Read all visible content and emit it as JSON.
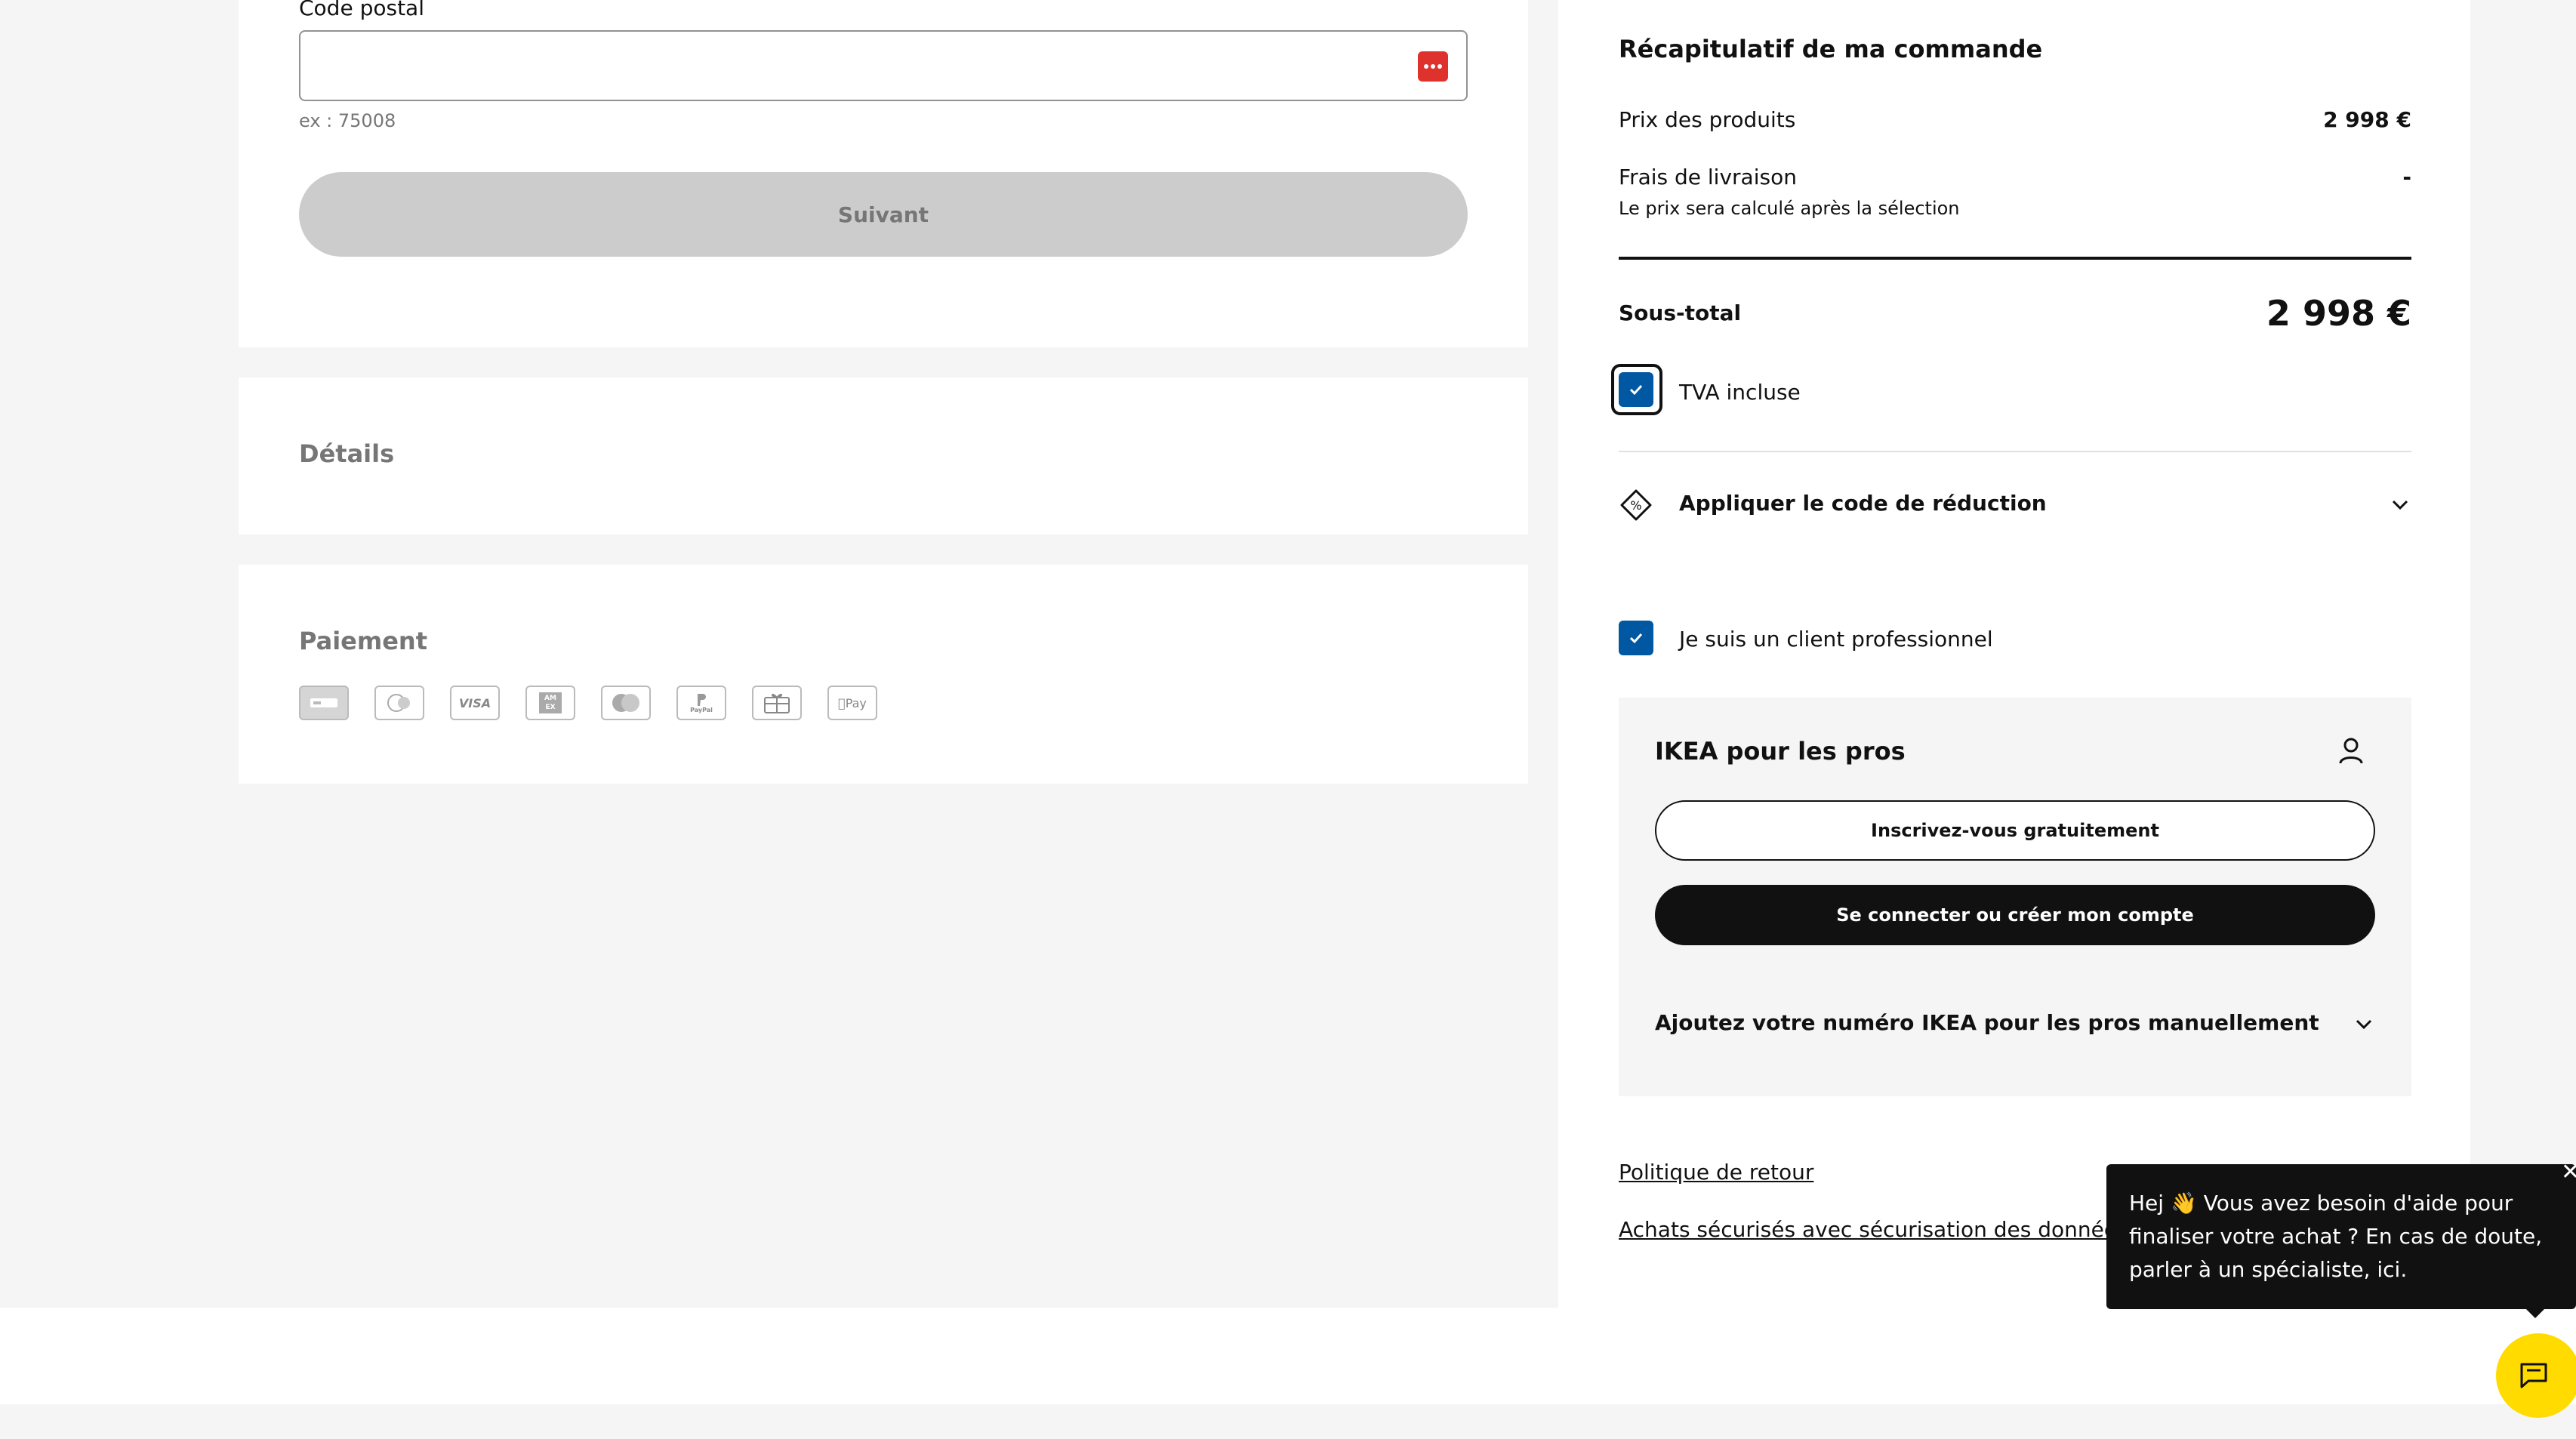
{
  "form": {
    "postal_label": "Code postal",
    "postal_value": "",
    "postal_hint": "ex : 75008",
    "next_button": "Suivant"
  },
  "details": {
    "title": "Détails"
  },
  "payment": {
    "title": "Paiement",
    "methods": [
      "carte-bancaire",
      "carte-cadeau",
      "VISA",
      "AMEX",
      "mastercard",
      "PayPal",
      "carte-ikea",
      "Apple Pay"
    ],
    "visa_text": "VISA",
    "applepay_text": "Pay",
    "paypal_text": "PayPal",
    "amex_text": "AM EX"
  },
  "summary": {
    "title": "Récapitulatif de ma commande",
    "products_label": "Prix des produits",
    "products_value": "2 998 €",
    "shipping_label": "Frais de livraison",
    "shipping_value": "-",
    "shipping_note": "Le prix sera calculé après la sélection",
    "subtotal_label": "Sous-total",
    "subtotal_value": "2 998 €",
    "vat_label": "TVA incluse",
    "vat_checked": true,
    "discount_label": "Appliquer le code de réduction",
    "pro_label": "Je suis un client professionnel",
    "pro_checked": true
  },
  "pro_panel": {
    "title": "IKEA pour les pros",
    "register_button": "Inscrivez-vous gratuitement",
    "login_button": "Se connecter ou créer mon compte",
    "manual_label": "Ajoutez votre numéro IKEA pour les pros manuellement"
  },
  "links": {
    "return_policy": "Politique de retour",
    "secure": "Achats sécurisés avec sécurisation des données S"
  },
  "chat": {
    "message": "Hej 👋 Vous avez besoin d'aide pour finaliser votre achat ? En cas de doute, parler à un spécialiste, ici.",
    "accent": "#ffdb00"
  },
  "colors": {
    "brand_blue": "#0058a3",
    "password_icon": "#e0322d"
  }
}
